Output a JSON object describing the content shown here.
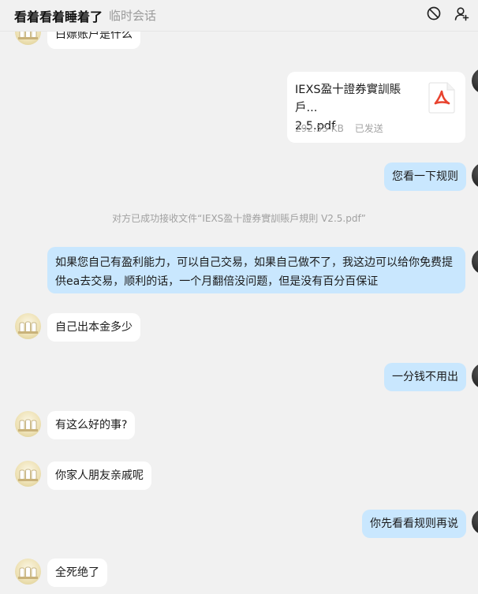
{
  "header": {
    "title": "看着看着睡着了",
    "subtitle": "临时会话",
    "block_icon": "block-icon",
    "add_contact_icon": "add-user-icon"
  },
  "messages": [
    {
      "side": "in",
      "text": "白嫖账户是什么"
    },
    {
      "side": "out",
      "type": "file",
      "file_name": "IEXS盈十證券實訓賬戶...\n2.5.pdf",
      "file_size": "292.55 KB",
      "status": "已发送"
    },
    {
      "side": "out",
      "text": "您看一下规则"
    },
    {
      "side": "system",
      "text": "对方已成功接收文件“IEXS盈十證券實訓賬戶規則 V2.5.pdf”"
    },
    {
      "side": "out",
      "text": "如果您自己有盈利能力，可以自己交易，如果自己做不了，我这边可以给你免费提供ea去交易，顺利的话，一个月翻倍没问题，但是没有百分百保证"
    },
    {
      "side": "in",
      "text": "自己出本金多少"
    },
    {
      "side": "out",
      "text": "一分钱不用出"
    },
    {
      "side": "in",
      "text": "有这么好的事?"
    },
    {
      "side": "in",
      "text": "你家人朋友亲戚呢"
    },
    {
      "side": "out",
      "text": "你先看看规则再说"
    },
    {
      "side": "in",
      "text": "全死绝了"
    }
  ],
  "colors": {
    "background": "#f1f1f1",
    "incoming_bubble": "#ffffff",
    "outgoing_bubble": "#c9e7fe",
    "pdf_red": "#e8432f"
  }
}
